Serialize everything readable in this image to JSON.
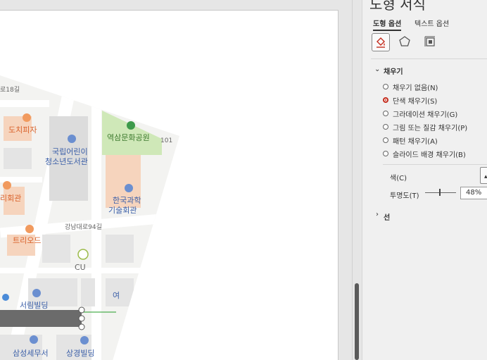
{
  "format_pane": {
    "title": "도형 서식",
    "tabs": [
      "도형 옵션",
      "텍스트 옵션"
    ],
    "category_icons": [
      "fill-line-icon",
      "effects-icon",
      "size-properties-icon"
    ],
    "fill_section": {
      "title": "채우기",
      "options": [
        {
          "label": "채우기 없음(N)",
          "checked": false
        },
        {
          "label": "단색 채우기(S)",
          "checked": true
        },
        {
          "label": "그라데이션 채우기(G)",
          "checked": false
        },
        {
          "label": "그림 또는 질감 채우기(P)",
          "checked": false
        },
        {
          "label": "패턴 채우기(A)",
          "checked": false
        },
        {
          "label": "슬라이드 배경 채우기(B)",
          "checked": false
        }
      ],
      "color_label": "색(C)",
      "transparency_label": "투명도(T)",
      "transparency_value": "48%",
      "transparency_level": 0.48
    },
    "line_section": {
      "title": "선"
    }
  },
  "map": {
    "labels": [
      "로18길",
      "도치피자",
      "국립어린이",
      "청소년도서관",
      "역삼문화공원",
      "101",
      "한국과학",
      "기술회관",
      "리회관",
      "강남대로94길",
      "트리오드",
      "CU",
      "여",
      "서림빌딩",
      "삼성세무서",
      "상경빌딩"
    ]
  },
  "colors": {
    "accent_red": "#c42b1c",
    "park_green": "#cfe8b8",
    "building_orange": "#f6d4bd",
    "selected_shape": "#6b6b6b",
    "connector_green": "#4caf50"
  }
}
